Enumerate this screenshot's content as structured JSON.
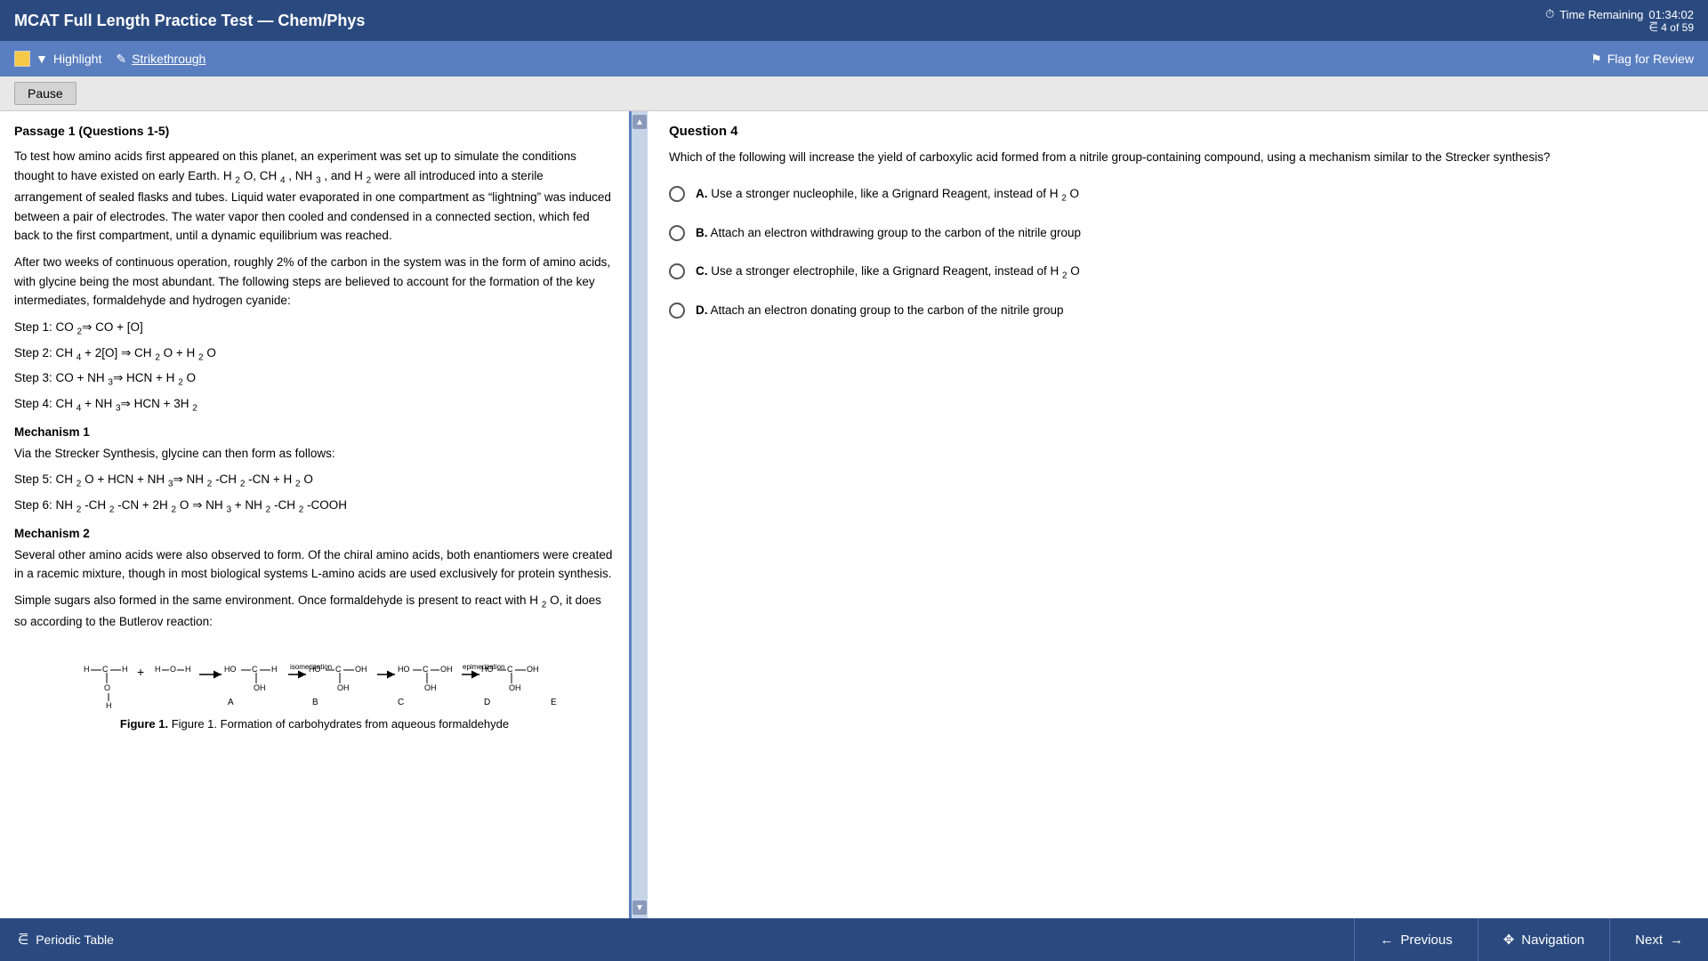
{
  "header": {
    "title": "MCAT Full Length Practice Test — Chem/Phys",
    "timer_label": "Time Remaining",
    "timer_value": "01:34:02",
    "question_count": "4 of 59"
  },
  "toolbar": {
    "highlight_label": "Highlight",
    "strikethrough_label": "Strikethrough",
    "flag_label": "Flag for Review"
  },
  "pause": {
    "label": "Pause"
  },
  "passage": {
    "title": "Passage 1 (Questions 1-5)",
    "paragraphs": [
      "To test how amino acids first appeared on this planet, an experiment was set up to simulate the conditions thought to have existed on early Earth. H₂O, CH₄, NH₃, and H₂ were all introduced into a sterile arrangement of sealed flasks and tubes. Liquid water evaporated in one compartment as \"lightning\" was induced between a pair of electrodes. The water vapor then cooled and condensed in a connected section, which fed back to the first compartment, until a dynamic equilibrium was reached.",
      "After two weeks of continuous operation, roughly 2% of the carbon in the system was in the form of amino acids, with glycine being the most abundant. The following steps are believed to account for the formation of the key intermediates, formaldehyde and hydrogen cyanide:"
    ],
    "steps": [
      "Step 1: CO₂⇒ CO + [O]",
      "Step 2: CH₄ + 2[O] ⇒ CH₂O + H₂O",
      "Step 3: CO + NH₃⇒ HCN + H₂O",
      "Step 4: CH₄ + NH₃⇒ HCN + 3H₂"
    ],
    "mechanism1_title": "Mechanism 1",
    "mechanism1_intro": "Via the Strecker Synthesis, glycine can then form as follows:",
    "mechanism1_steps": [
      "Step 5: CH₂O + HCN + NH₃⇒ NH₂-CH₂-CN + H₂O",
      "Step 6: NH₂-CH₂-CN + 2H₂O ⇒ NH₃ + NH₂-CH₂-COOH"
    ],
    "mechanism2_title": "Mechanism 2",
    "mechanism2_paragraphs": [
      "Several other amino acids were also observed to form. Of the chiral amino acids, both enantiomers were created in a racemic mixture, though in most biological systems L-amino acids are used exclusively for protein synthesis.",
      "Simple sugars also formed in the same environment. Once formaldehyde is present to react with H₂O, it does so according to the Butlerov reaction:"
    ],
    "figure_caption": "Figure 1. Formation of carbohydrates from aqueous formaldehyde"
  },
  "question": {
    "number": "Question 4",
    "text": "Which of the following will increase the yield of carboxylic acid formed from a nitrile group-containing compound, using a mechanism similar to the Strecker synthesis?",
    "options": [
      {
        "letter": "A",
        "text": "Use a stronger nucleophile, like a Grignard Reagent, instead of H₂O"
      },
      {
        "letter": "B",
        "text": "Attach an electron withdrawing group to the carbon of the nitrile group"
      },
      {
        "letter": "C",
        "text": "Use a stronger electrophile, like a Grignard Reagent, instead of H₂O"
      },
      {
        "letter": "D",
        "text": "Attach an electron donating group to the carbon of the nitrile group"
      }
    ]
  },
  "footer": {
    "periodic_table_label": "Periodic Table",
    "previous_label": "Previous",
    "navigation_label": "Navigation",
    "next_label": "Next"
  }
}
